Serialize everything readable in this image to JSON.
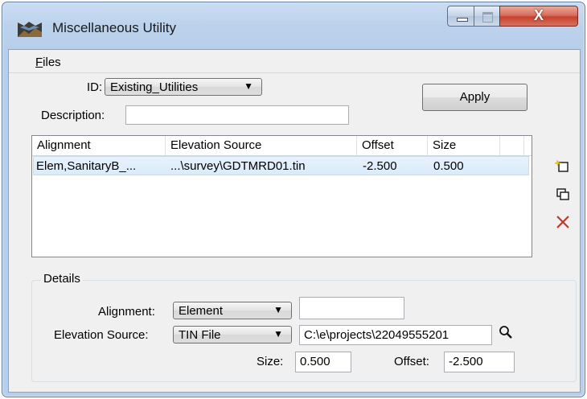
{
  "window": {
    "title": "Miscellaneous Utility",
    "icons": {
      "app": "app-icon",
      "minimize": "minimize-icon",
      "maximize": "maximize-icon",
      "close": "close-icon"
    },
    "close_glyph": "X"
  },
  "menu": {
    "files_label": "Files",
    "files_accel": "F",
    "files_rest": "iles"
  },
  "form": {
    "id_label": "ID:",
    "id_value": "Existing_Utilities",
    "description_label": "Description:",
    "description_value": "",
    "apply_label": "Apply"
  },
  "table": {
    "columns": [
      "Alignment",
      "Elevation Source",
      "Offset",
      "Size"
    ],
    "rows": [
      {
        "alignment": "Elem,SanitaryB_...",
        "elevation_source": "...\\survey\\GDTMRD01.tin",
        "offset": "-2.500",
        "size": "0.500"
      }
    ]
  },
  "side_icons": [
    "add-icon",
    "copy-icon",
    "delete-icon"
  ],
  "details": {
    "title": "Details",
    "alignment_label": "Alignment:",
    "alignment_value": "Element",
    "alignment_text": "",
    "elevation_source_label": "Elevation Source:",
    "elevation_source_value": "TIN File",
    "elevation_path": "C:\\e\\projects\\22049555201",
    "size_label": "Size:",
    "size_value": "0.500",
    "offset_label": "Offset:",
    "offset_value": "-2.500",
    "browse_icon": "magnifier-icon"
  },
  "colors": {
    "title_bar": "#b9d1ea",
    "close_button": "#c7412d",
    "selection": "#d9ebfb",
    "delete_red": "#c0392b"
  }
}
